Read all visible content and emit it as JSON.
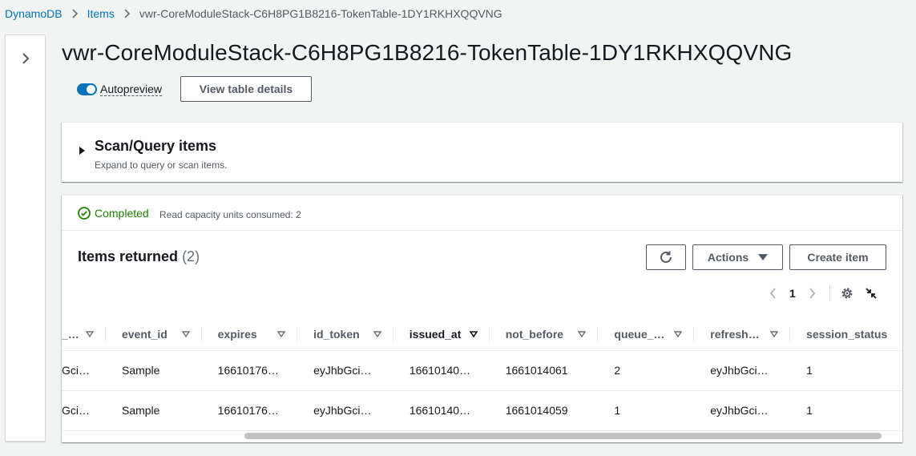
{
  "breadcrumb": {
    "items": [
      {
        "label": "DynamoDB"
      },
      {
        "label": "Items"
      },
      {
        "label": "vwr-CoreModuleStack-C6H8PG1B8216-TokenTable-1DY1RKHXQQVNG"
      }
    ]
  },
  "page": {
    "title": "vwr-CoreModuleStack-C6H8PG1B8216-TokenTable-1DY1RKHXQQVNG",
    "autopreview_label": "Autopreview",
    "autopreview_on": true,
    "view_details_label": "View table details"
  },
  "scan": {
    "title": "Scan/Query items",
    "description": "Expand to query or scan items."
  },
  "results": {
    "status_label": "Completed",
    "rcu_text": "Read capacity units consumed: 2",
    "items_title": "Items returned",
    "items_count": "(2)",
    "actions_label": "Actions",
    "create_label": "Create item",
    "page_number": "1",
    "columns": [
      {
        "label": "_…"
      },
      {
        "label": "event_id"
      },
      {
        "label": "expires"
      },
      {
        "label": "id_token"
      },
      {
        "label": "issued_at"
      },
      {
        "label": "not_before"
      },
      {
        "label": "queue_…"
      },
      {
        "label": "refresh…"
      },
      {
        "label": "session_status"
      }
    ],
    "rows": [
      [
        "Gci…",
        "Sample",
        "16610176…",
        "eyJhbGci…",
        "16610140…",
        "1661014061",
        "2",
        "eyJhbGci…",
        "1"
      ],
      [
        "Gci…",
        "Sample",
        "16610176…",
        "eyJhbGci…",
        "16610140…",
        "1661014059",
        "1",
        "eyJhbGci…",
        "1"
      ]
    ]
  },
  "colors": {
    "link": "#0073bb",
    "success": "#1d8102",
    "toggle_on": "#0073bb"
  },
  "icons": {
    "breadcrumb_separator": "chevron-right-icon",
    "side_toggle": "chevron-right-icon",
    "scan_expand": "caret-right-icon",
    "status": "check-circle-icon",
    "refresh": "refresh-icon",
    "actions": "caret-down-icon",
    "pager_prev": "chevron-left-icon",
    "pager_next": "chevron-right-icon",
    "settings": "gear-icon",
    "collapse": "shrink-icon",
    "column_sort": "sort-triangle-icon"
  }
}
